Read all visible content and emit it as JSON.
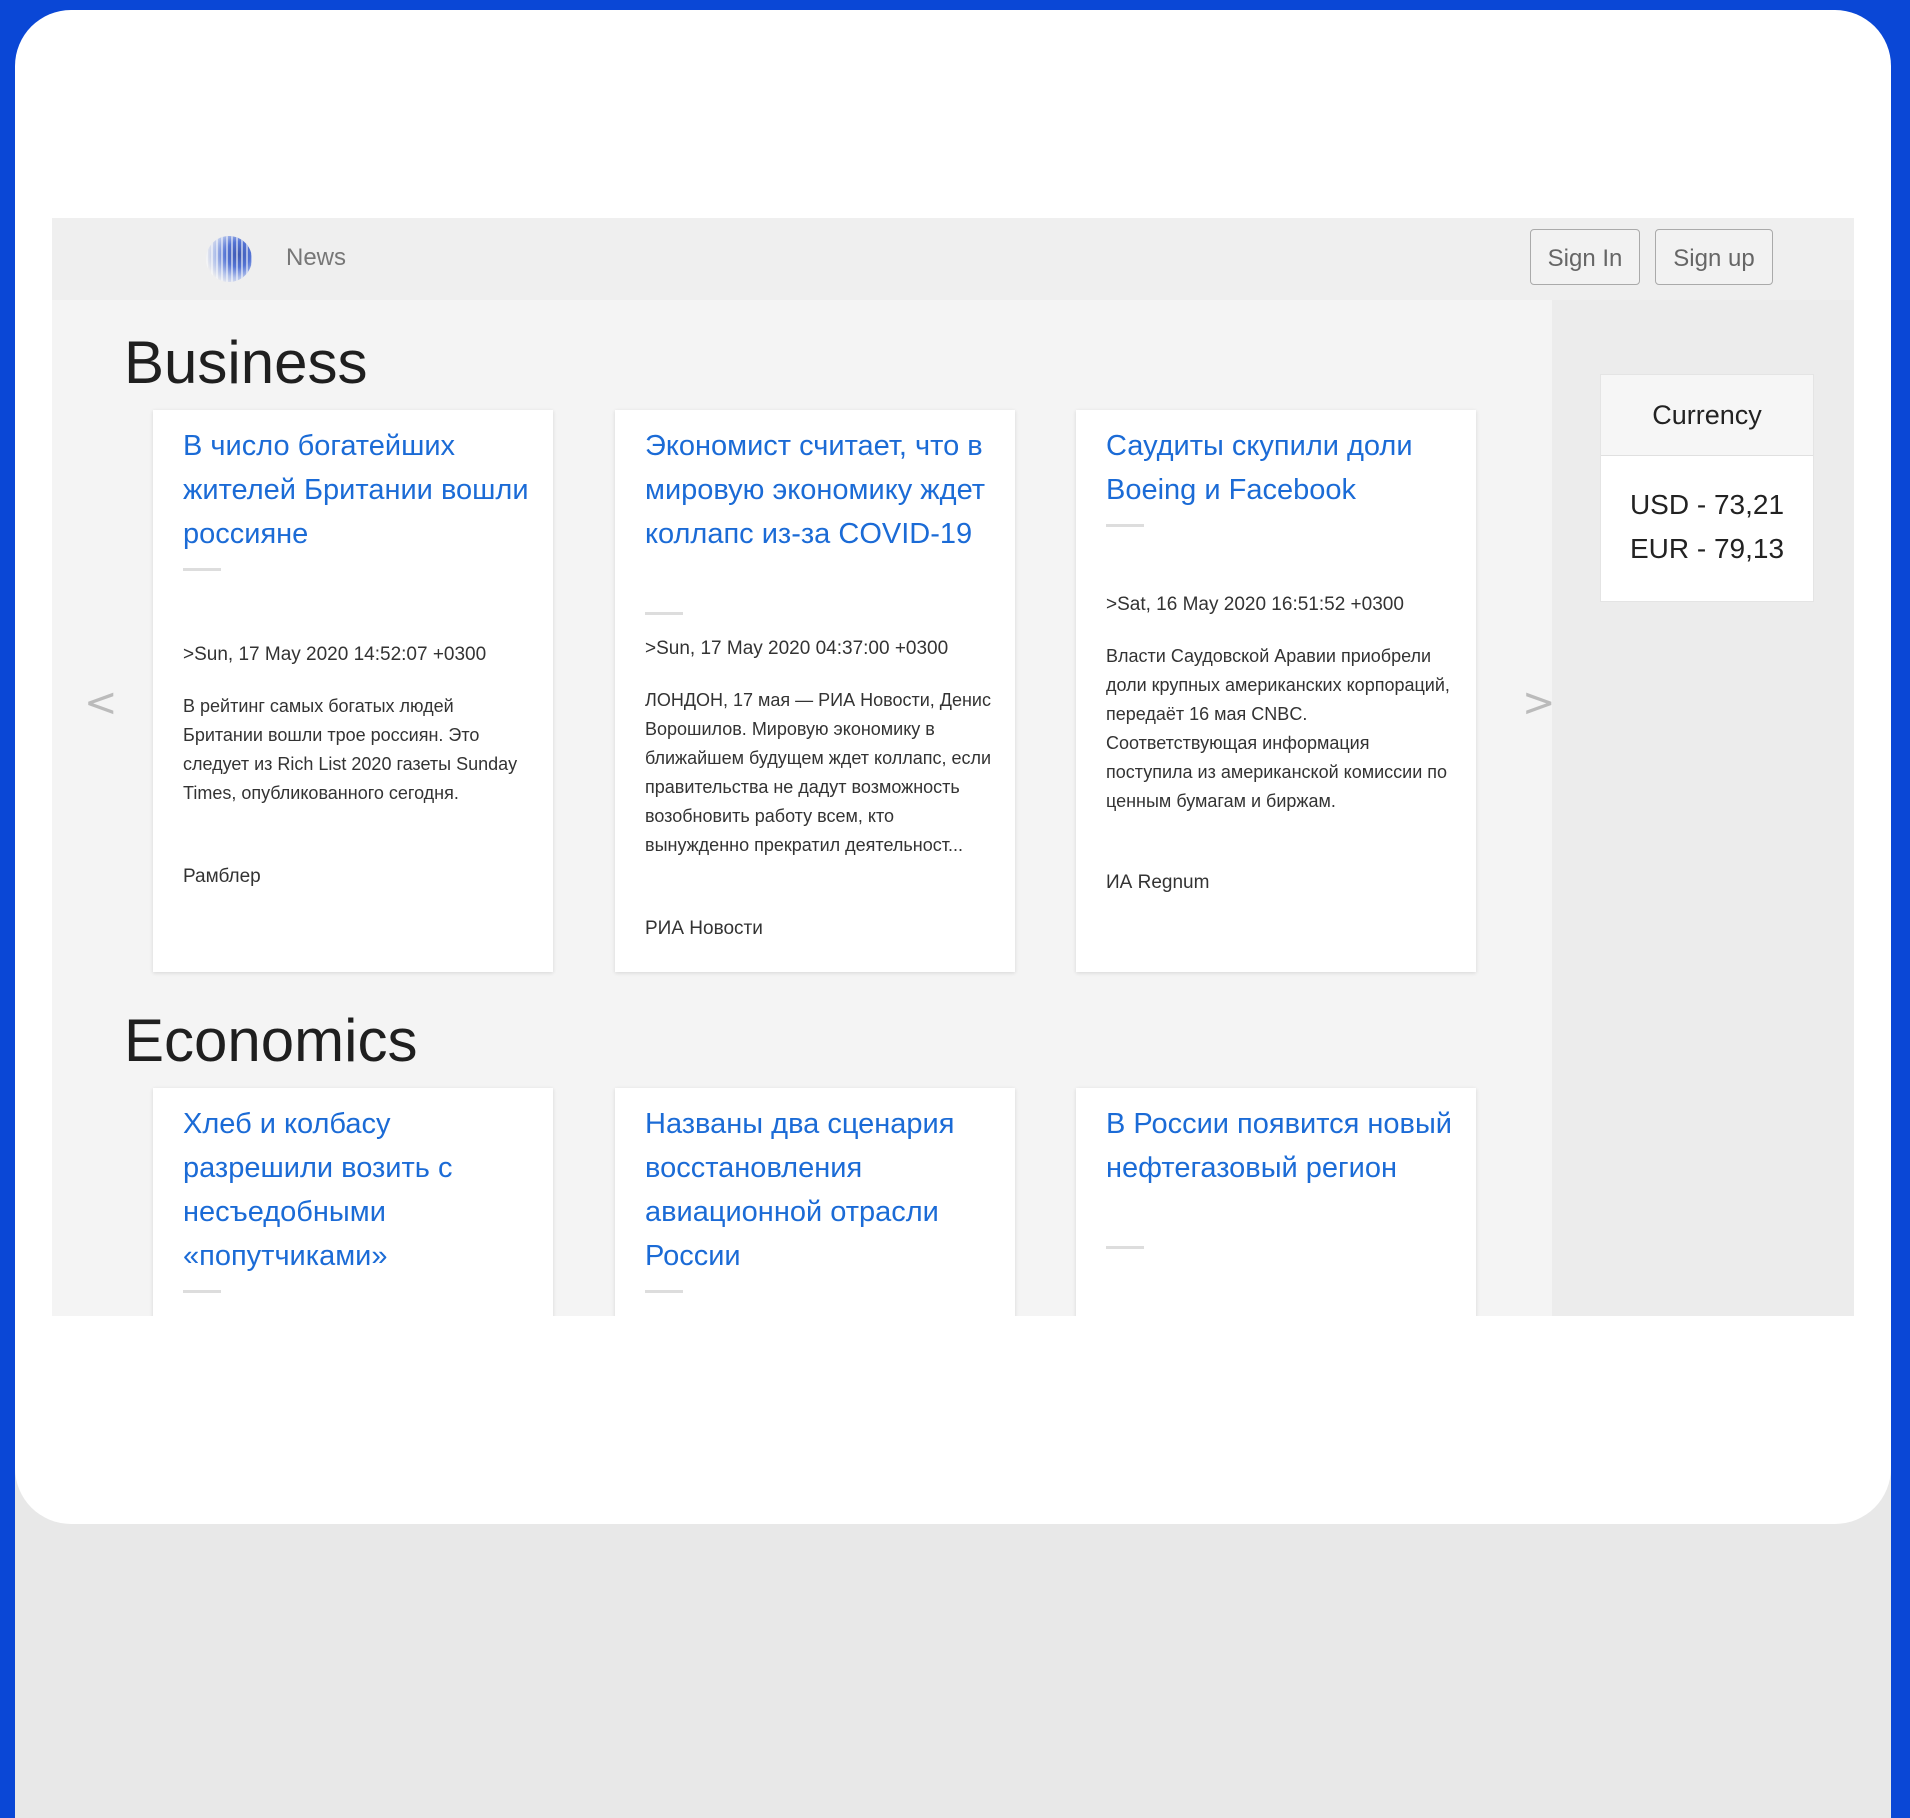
{
  "nav": {
    "brand": "News",
    "sign_in": "Sign In",
    "sign_up": "Sign up"
  },
  "sections": [
    {
      "title": "Business",
      "cards": [
        {
          "title": "В число богатейших жителей Британии вошли россияне",
          "date": ">Sun, 17 May 2020 14:52:07 +0300",
          "description": "В рейтинг самых богатых людей Британии вошли трое россиян. Это следует из Rich List 2020 газеты Sunday Times, опубликованного сегодня.",
          "source": "Рамблер"
        },
        {
          "title": "Экономист считает, что в мировую экономику ждет коллапс из-за COVID-19",
          "date": ">Sun, 17 May 2020 04:37:00 +0300",
          "description": "ЛОНДОН, 17 мая — РИА Новости, Денис Ворошилов. Мировую экономику в ближайшем будущем ждет коллапс, если правительства не дадут возможность возобновить работу всем, кто вынужденно прекратил деятельност...",
          "source": "РИА Новости"
        },
        {
          "title": "Саудиты скупили доли Boeing и Facebook",
          "date": ">Sat, 16 May 2020 16:51:52 +0300",
          "description": "Власти Саудовской Аравии приобрели доли крупных американских корпораций, передаёт 16 мая CNBC. Соответствующая информация поступила из американской комиссии по ценным бумагам и биржам.",
          "source": "ИА Regnum"
        }
      ]
    },
    {
      "title": "Economics",
      "cards": [
        {
          "title": "Хлеб и колбасу разрешили возить с несъедобными «попутчиками»"
        },
        {
          "title": "Названы два сценария восстановления авиационной отрасли России"
        },
        {
          "title": "В России появится новый нефтегазовый регион"
        }
      ]
    }
  ],
  "carousel": {
    "prev": "<",
    "next": ">"
  },
  "currency": {
    "title": "Currency",
    "usd": "USD - 73,21",
    "eur": "EUR - 79,13"
  },
  "colors": {
    "background": "#0a47d6",
    "link": "#1b6bd6"
  }
}
